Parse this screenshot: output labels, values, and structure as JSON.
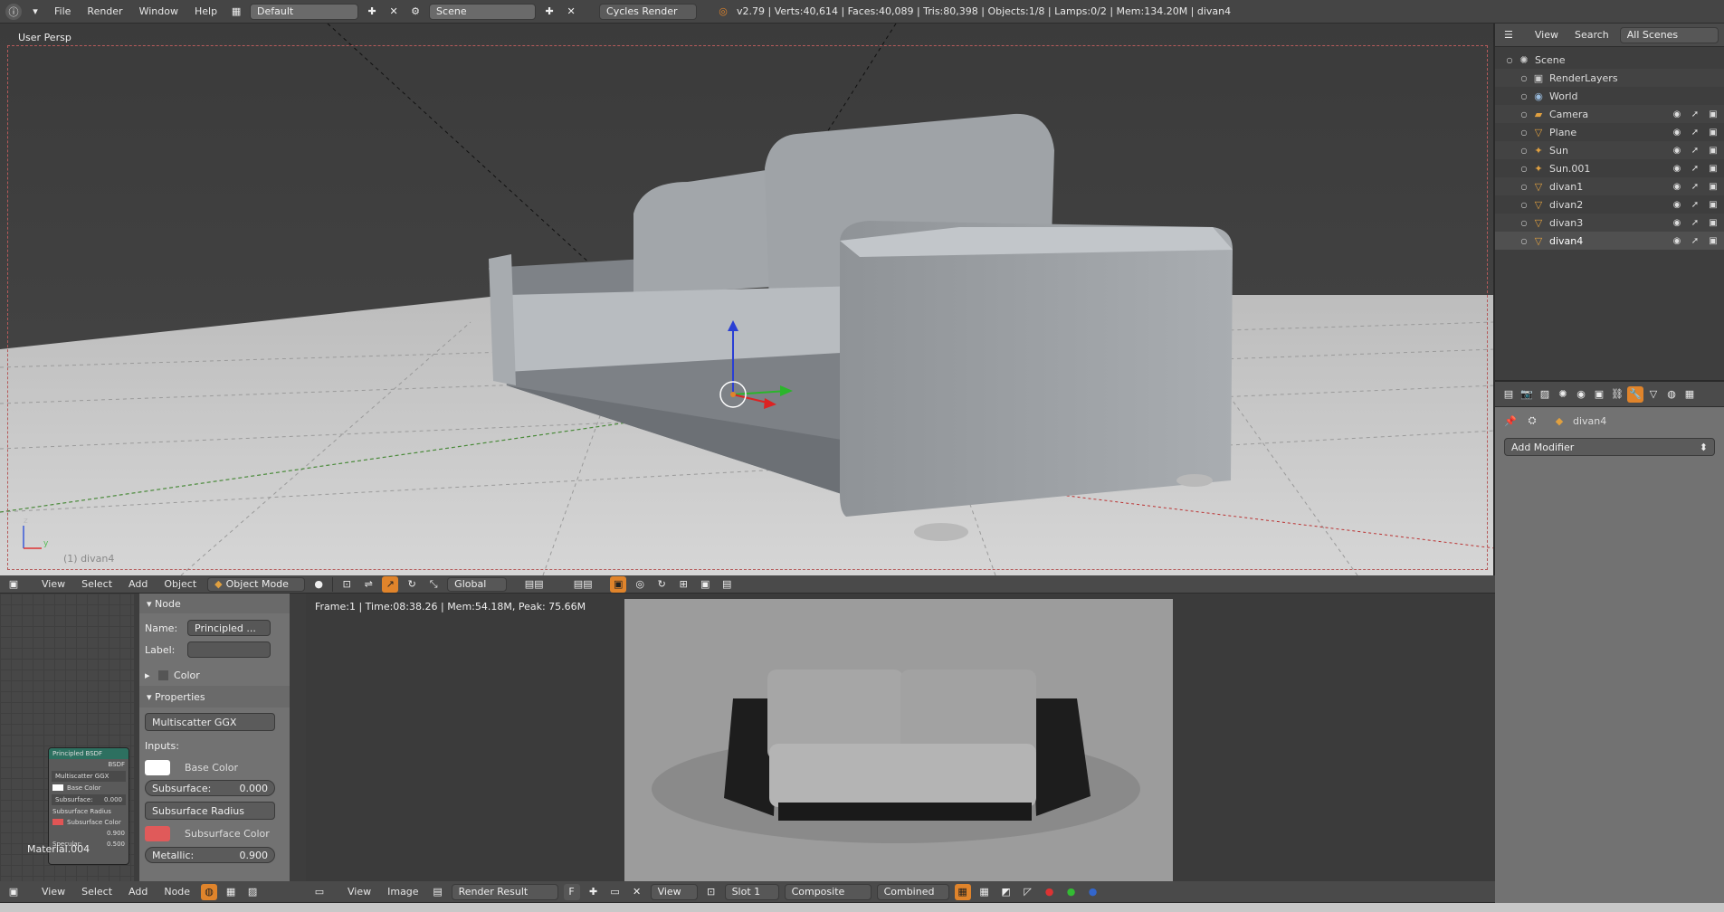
{
  "topbar": {
    "menus": [
      "File",
      "Render",
      "Window",
      "Help"
    ],
    "layout": "Default",
    "scene": "Scene",
    "engine": "Cycles Render",
    "stats": "v2.79 | Verts:40,614 | Faces:40,089 | Tris:80,398 | Objects:1/8 | Lamps:0/2 | Mem:134.20M | divan4"
  },
  "viewport": {
    "label": "User Persp",
    "footer_obj": "(1) divan4",
    "axis_z": "z",
    "axis_xy": "y"
  },
  "vp_header": {
    "menus": [
      "View",
      "Select",
      "Add",
      "Object"
    ],
    "mode": "Object Mode",
    "orientation": "Global"
  },
  "outliner": {
    "menus": [
      "View",
      "Search"
    ],
    "filter": "All Scenes",
    "items": [
      {
        "name": "Scene",
        "indent": 0,
        "icon": "scene-icon"
      },
      {
        "name": "RenderLayers",
        "indent": 1,
        "icon": "renderlayers-icon"
      },
      {
        "name": "World",
        "indent": 1,
        "icon": "world-icon"
      },
      {
        "name": "Camera",
        "indent": 1,
        "icon": "camera-icon"
      },
      {
        "name": "Plane",
        "indent": 1,
        "icon": "mesh-icon"
      },
      {
        "name": "Sun",
        "indent": 1,
        "icon": "lamp-icon"
      },
      {
        "name": "Sun.001",
        "indent": 1,
        "icon": "lamp-icon"
      },
      {
        "name": "divan1",
        "indent": 1,
        "icon": "mesh-icon"
      },
      {
        "name": "divan2",
        "indent": 1,
        "icon": "mesh-icon"
      },
      {
        "name": "divan3",
        "indent": 1,
        "icon": "mesh-icon"
      },
      {
        "name": "divan4",
        "indent": 1,
        "icon": "mesh-icon",
        "selected": true
      }
    ]
  },
  "properties": {
    "object": "divan4",
    "add_modifier": "Add Modifier"
  },
  "node_panel": {
    "node_header": "Node",
    "name_label": "Name:",
    "name_value": "Principled ...",
    "label_label": "Label:",
    "color_header": "Color",
    "properties_header": "Properties",
    "distribution": "Multiscatter GGX",
    "inputs": "Inputs:",
    "base_color": "Base Color",
    "subsurface_label": "Subsurface:",
    "subsurface_value": "0.000",
    "subsurface_radius": "Subsurface Radius",
    "subsurface_color": "Subsurface Color",
    "metallic_label": "Metallic:",
    "metallic_value": "0.900",
    "material": "Material.004",
    "mini_node": {
      "title": "Principled BSDF",
      "bsdf": "BSDF",
      "dist": "Multiscatter GGX",
      "base": "Base Color",
      "ss": "Subsurface:",
      "ssv": "0.000",
      "ssr": "Subsurface Radius",
      "ssc": "Subsurface Color",
      "v1": "0.900",
      "spec": "Specular:",
      "specv": "0.500"
    }
  },
  "node_header": {
    "menus": [
      "View",
      "Select",
      "Add",
      "Node"
    ]
  },
  "image_editor": {
    "status": "Frame:1 | Time:08:38.26 | Mem:54.18M, Peak: 75.66M",
    "menus": [
      "View",
      "Image"
    ],
    "image": "Render Result",
    "f": "F",
    "view": "View",
    "slot": "Slot 1",
    "composite": "Composite",
    "pass": "Combined"
  },
  "colors": {
    "accent": "#e0842b",
    "bg": "#727272",
    "selected": "#3f3f3f"
  }
}
